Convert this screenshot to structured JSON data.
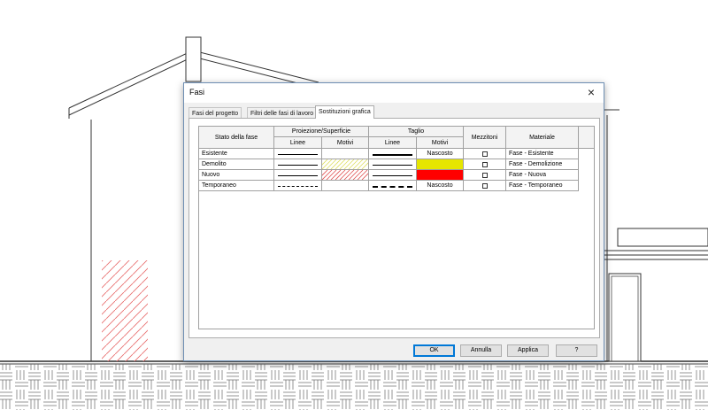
{
  "dialog": {
    "title": "Fasi",
    "close_symbol": "×",
    "tabs": [
      {
        "label": "Fasi del progetto",
        "active": false
      },
      {
        "label": "Filtri delle fasi di lavoro",
        "active": false
      },
      {
        "label": "Sostituzioni grafica",
        "active": true
      }
    ],
    "table": {
      "headers": {
        "stato": "Stato della fase",
        "proiezione": "Proiezione/Superficie",
        "taglio": "Taglio",
        "linee": "Linee",
        "motivi": "Motivi",
        "mezzitoni": "Mezzitoni",
        "materiale": "Materiale"
      },
      "rows": [
        {
          "stato": "Esistente",
          "proj_line": "thin-solid",
          "proj_pattern": "none",
          "cut_line": "thick-solid",
          "cut_pattern_text": "Nascosto",
          "cut_pattern_color": "",
          "mezzitoni": false,
          "materiale": "Fase - Esistente"
        },
        {
          "stato": "Demolito",
          "proj_line": "thin-solid",
          "proj_pattern": "yellow-hatch",
          "cut_line": "thin-solid",
          "cut_pattern_text": "",
          "cut_pattern_color": "#e6e600",
          "mezzitoni": false,
          "materiale": "Fase - Demolizione"
        },
        {
          "stato": "Nuovo",
          "proj_line": "thin-solid",
          "proj_pattern": "red-hatch",
          "cut_line": "thin-solid",
          "cut_pattern_text": "",
          "cut_pattern_color": "#ff0000",
          "mezzitoni": false,
          "materiale": "Fase - Nuova"
        },
        {
          "stato": "Temporaneo",
          "proj_line": "dashed",
          "proj_pattern": "none",
          "cut_line": "thick-dashed",
          "cut_pattern_text": "Nascosto",
          "cut_pattern_color": "",
          "mezzitoni": false,
          "materiale": "Fase - Temporaneo"
        }
      ]
    },
    "buttons": {
      "ok": "OK",
      "cancel": "Annulla",
      "apply": "Applica",
      "help": "?"
    }
  },
  "colors": {
    "hatch_yellow": "#dede60",
    "hatch_red": "#e05050",
    "drawing_red_hatch": "#e87070",
    "dialog_border": "#6f8fb4",
    "default_button": "#0078d7"
  }
}
